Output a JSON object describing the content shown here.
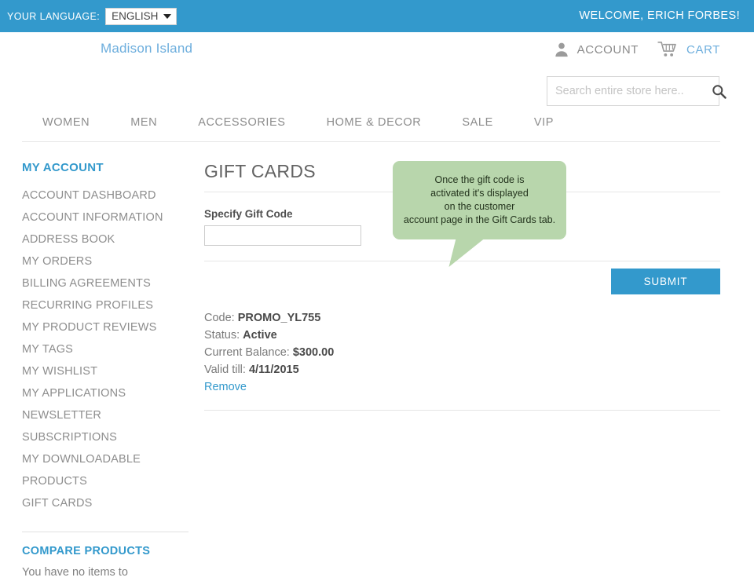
{
  "topbar": {
    "language_label": "YOUR LANGUAGE:",
    "language_selected": "ENGLISH",
    "welcome": "WELCOME, ERICH FORBES!",
    "bg_color": "#3399cc"
  },
  "header": {
    "logo": "Madison Island",
    "account_label": "ACCOUNT",
    "cart_label": "CART",
    "account_icon": "person-icon",
    "cart_icon": "shopping-cart-icon"
  },
  "search": {
    "placeholder": "Search entire store here..",
    "value": "",
    "icon": "search-icon"
  },
  "nav": {
    "items": [
      {
        "label": "WOMEN"
      },
      {
        "label": "MEN"
      },
      {
        "label": "ACCESSORIES"
      },
      {
        "label": "HOME & DECOR"
      },
      {
        "label": "SALE"
      },
      {
        "label": "VIP"
      }
    ]
  },
  "sidebar": {
    "title": "MY ACCOUNT",
    "items": [
      {
        "label": "ACCOUNT DASHBOARD"
      },
      {
        "label": "ACCOUNT INFORMATION"
      },
      {
        "label": "ADDRESS BOOK"
      },
      {
        "label": "MY ORDERS"
      },
      {
        "label": "BILLING AGREEMENTS"
      },
      {
        "label": "RECURRING PROFILES"
      },
      {
        "label": "MY PRODUCT REVIEWS"
      },
      {
        "label": "MY TAGS"
      },
      {
        "label": "MY WISHLIST"
      },
      {
        "label": "MY APPLICATIONS"
      },
      {
        "label": "NEWSLETTER SUBSCRIPTIONS"
      },
      {
        "label": "MY DOWNLOADABLE PRODUCTS"
      },
      {
        "label": "GIFT CARDS"
      }
    ],
    "compare_title": "COMPARE PRODUCTS",
    "compare_text": "You have no items to"
  },
  "main": {
    "page_title": "GIFT CARDS",
    "gift_code_label": "Specify Gift Code",
    "gift_code_value": "",
    "submit_label": "SUBMIT",
    "card": {
      "code_label": "Code:",
      "code_value": "PROMO_YL755",
      "status_label": "Status:",
      "status_value": "Active",
      "balance_label": "Current Balance:",
      "balance_value": "$300.00",
      "valid_label": "Valid till:",
      "valid_value": "4/11/2015",
      "remove_label": "Remove"
    }
  },
  "tooltip": {
    "line1": "Once the gift code is",
    "line2": "activated it's displayed",
    "line3": "on the customer",
    "line4": "account page in the Gift Cards tab.",
    "bg_color": "#b8d6ac"
  }
}
